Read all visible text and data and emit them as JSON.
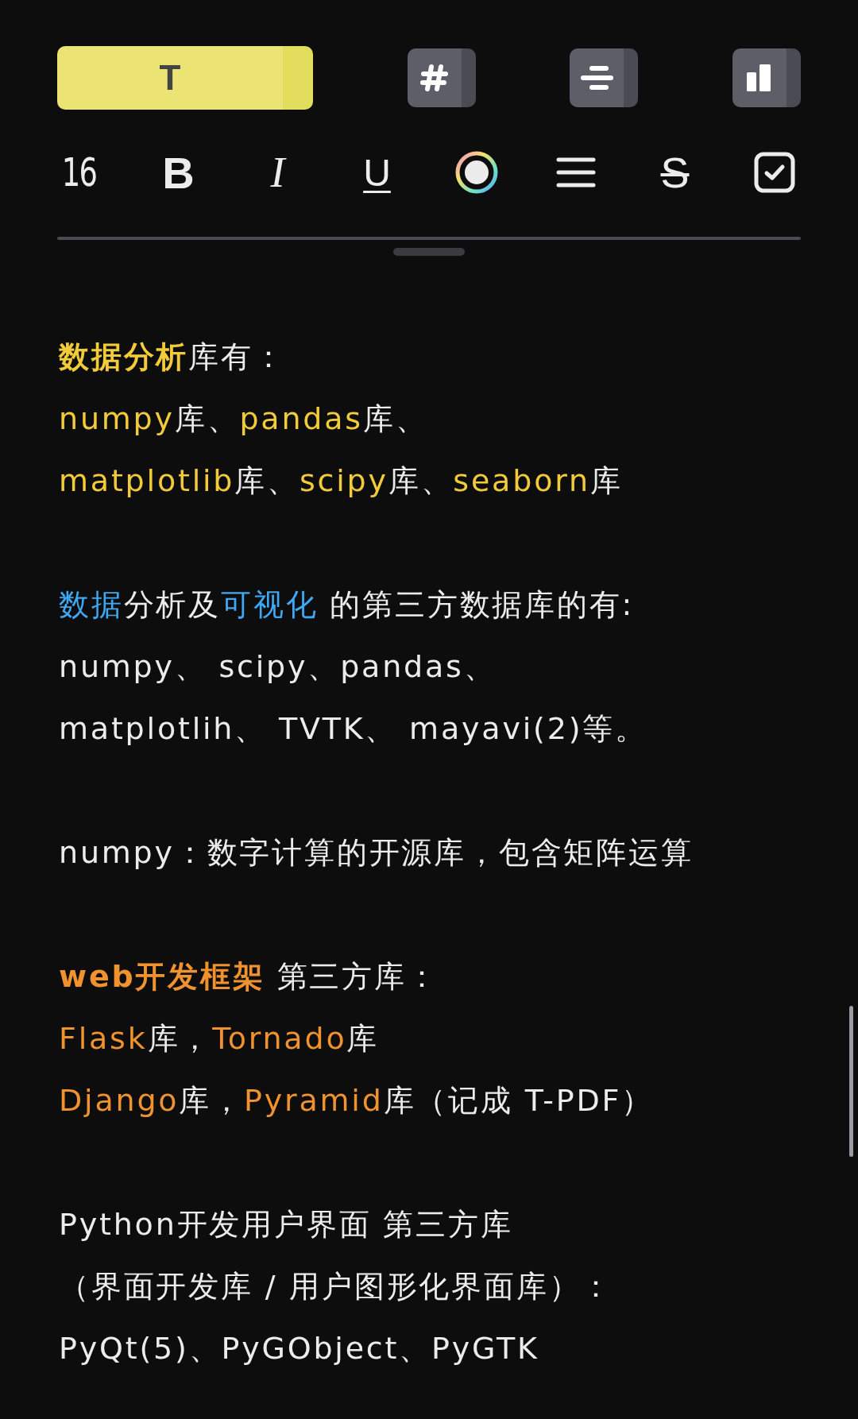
{
  "mode_tabs": [
    {
      "kind": "text",
      "label": "T",
      "selected": true
    },
    {
      "kind": "hash",
      "selected": false
    },
    {
      "kind": "lines",
      "selected": false
    },
    {
      "kind": "columns",
      "selected": false
    }
  ],
  "format_bar": [
    {
      "kind": "size",
      "label": "16"
    },
    {
      "kind": "bold",
      "label": "B"
    },
    {
      "kind": "italic",
      "label": "I"
    },
    {
      "kind": "underline",
      "label": "U"
    },
    {
      "kind": "color"
    },
    {
      "kind": "align"
    },
    {
      "kind": "strike",
      "label": "S"
    },
    {
      "kind": "checkbox"
    }
  ],
  "blocks": [
    {
      "lines": [
        [
          {
            "text": "数据分析",
            "color": "#f2cb3a",
            "bold": true
          },
          {
            "text": "库有："
          }
        ],
        [
          {
            "text": "numpy",
            "color": "#f2cb3a"
          },
          {
            "text": "库、"
          },
          {
            "text": "pandas",
            "color": "#f2cb3a"
          },
          {
            "text": "库、"
          }
        ],
        [
          {
            "text": "matplotlib",
            "color": "#f2cb3a"
          },
          {
            "text": "库、"
          },
          {
            "text": "scipy",
            "color": "#f2cb3a"
          },
          {
            "text": "库、"
          },
          {
            "text": "seaborn",
            "color": "#f2cb3a"
          },
          {
            "text": "库"
          }
        ]
      ]
    },
    {
      "lines": [
        [
          {
            "text": "数据",
            "color": "#3fa9f5"
          },
          {
            "text": "分析及"
          },
          {
            "text": "可视化",
            "color": "#3fa9f5"
          },
          {
            "text": " 的第三方数据库的有:"
          }
        ],
        [
          {
            "text": "numpy、 scipy、pandas、"
          }
        ],
        [
          {
            "text": "matplotlih、 TVTK、 mayavi(2)等。"
          }
        ]
      ]
    },
    {
      "lines": [
        [
          {
            "text": "numpy：数字计算的开源库，包含矩阵运算"
          }
        ]
      ]
    },
    {
      "lines": [
        [
          {
            "text": "web开发框架",
            "color": "#f0922e",
            "bold": true
          },
          {
            "text": " 第三方库："
          }
        ],
        [
          {
            "text": "Flask",
            "color": "#f0922e"
          },
          {
            "text": "库，"
          },
          {
            "text": "Tornado",
            "color": "#f0922e"
          },
          {
            "text": "库"
          }
        ],
        [
          {
            "text": "Django",
            "color": "#f0922e"
          },
          {
            "text": "库，"
          },
          {
            "text": "Pyramid",
            "color": "#f0922e"
          },
          {
            "text": "库（记成 T-PDF）"
          }
        ]
      ]
    },
    {
      "lines": [
        [
          {
            "text": "Python开发用户界面 第三方库"
          }
        ],
        [
          {
            "text": "（界面开发库 / 用户图形化界面库）："
          }
        ],
        [
          {
            "text": "PyQt(5)、PyGObject、PyGTK"
          }
        ]
      ]
    }
  ]
}
